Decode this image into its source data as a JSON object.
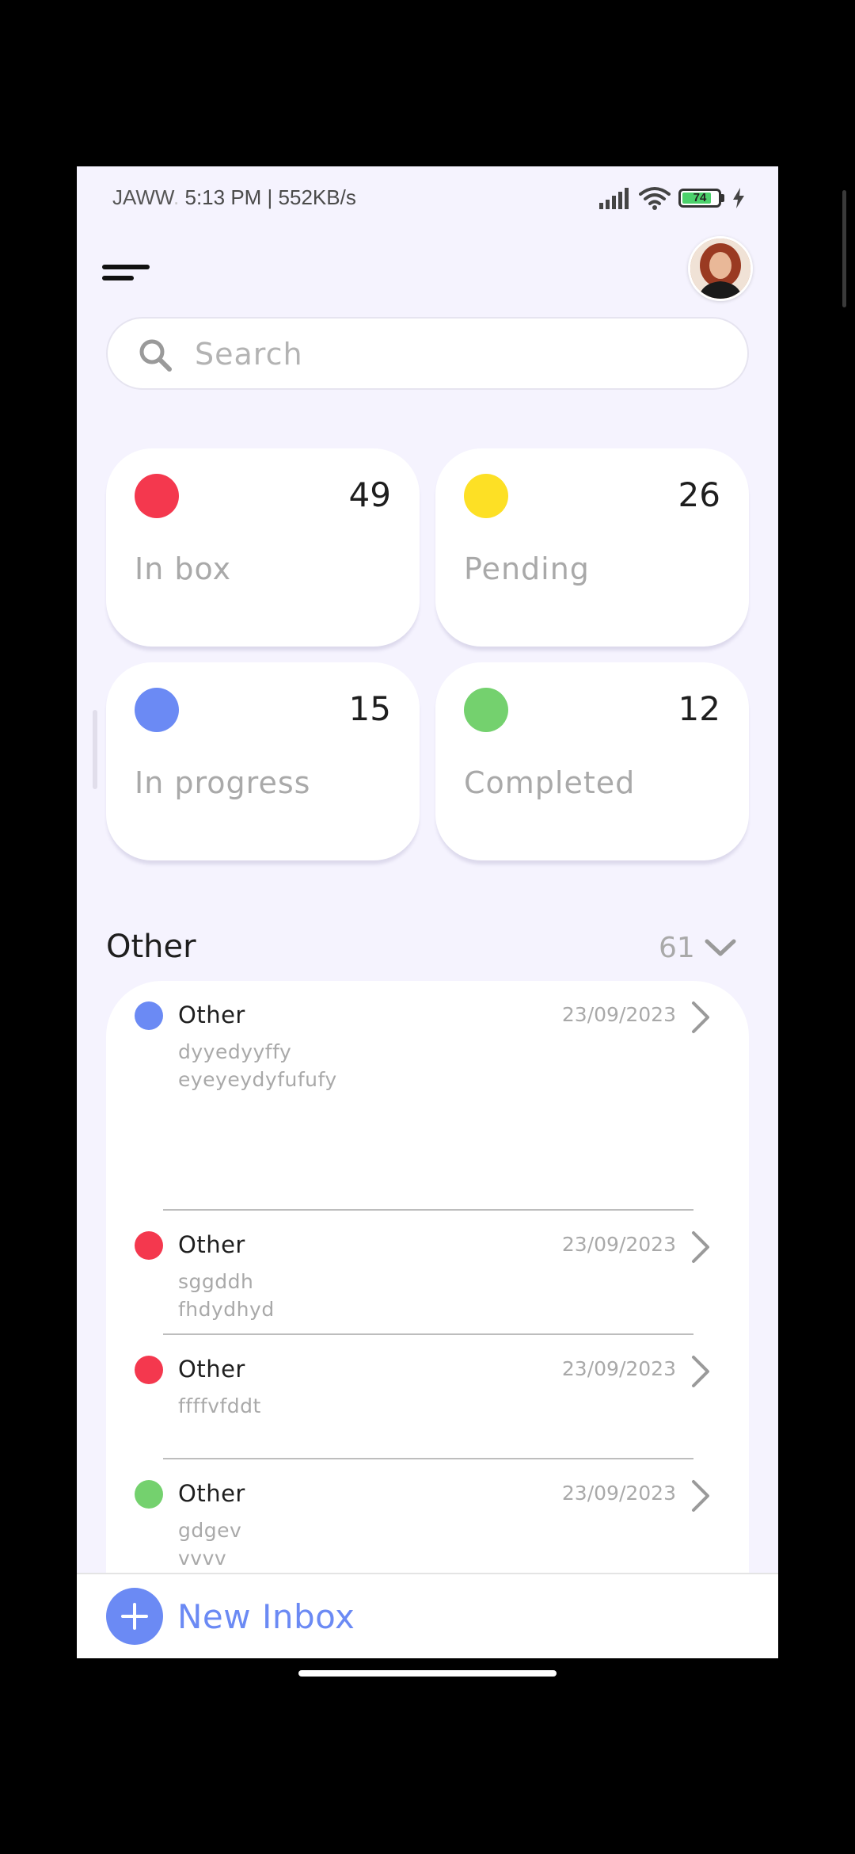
{
  "status_bar": {
    "carrier": "JAWW",
    "carrier_fade": ".",
    "time_speed": "5:13 PM | 552KB/s",
    "battery": "74",
    "icons": [
      "signal-icon",
      "wifi-icon",
      "battery-icon",
      "charging-icon"
    ]
  },
  "header": {
    "menu_icon": "menu-icon",
    "avatar": "user-avatar"
  },
  "search": {
    "placeholder": "Search",
    "value": "",
    "icon": "search-icon"
  },
  "cards": [
    {
      "label": "In box",
      "count": "49",
      "color": "#f4384e"
    },
    {
      "label": "Pending",
      "count": "26",
      "color": "#fde025"
    },
    {
      "label": "In progress",
      "count": "15",
      "color": "#6b8af4"
    },
    {
      "label": "Completed",
      "count": "12",
      "color": "#74d16e"
    }
  ],
  "section": {
    "title": "Other",
    "count": "61",
    "chevron_icon": "chevron-down-icon"
  },
  "items": [
    {
      "title": "Other",
      "date": "23/09/2023",
      "desc": "dyyedyyffy\neyeyeydyfufufy",
      "color": "#6b8af4"
    },
    {
      "title": "Other",
      "date": "23/09/2023",
      "desc": "sggddh\nfhdydhyd",
      "color": "#f4384e"
    },
    {
      "title": "Other",
      "date": "23/09/2023",
      "desc": "ffffvfddt",
      "color": "#f4384e"
    },
    {
      "title": "Other",
      "date": "23/09/2023",
      "desc": "gdgev\nvvvv",
      "color": "#74d16e"
    }
  ],
  "bottom": {
    "new_inbox_label": "New Inbox",
    "plus_icon": "plus-icon"
  },
  "colors": {
    "accent": "#6b8af4",
    "background": "#f5f3fe",
    "muted_text": "#a9a9a9"
  }
}
